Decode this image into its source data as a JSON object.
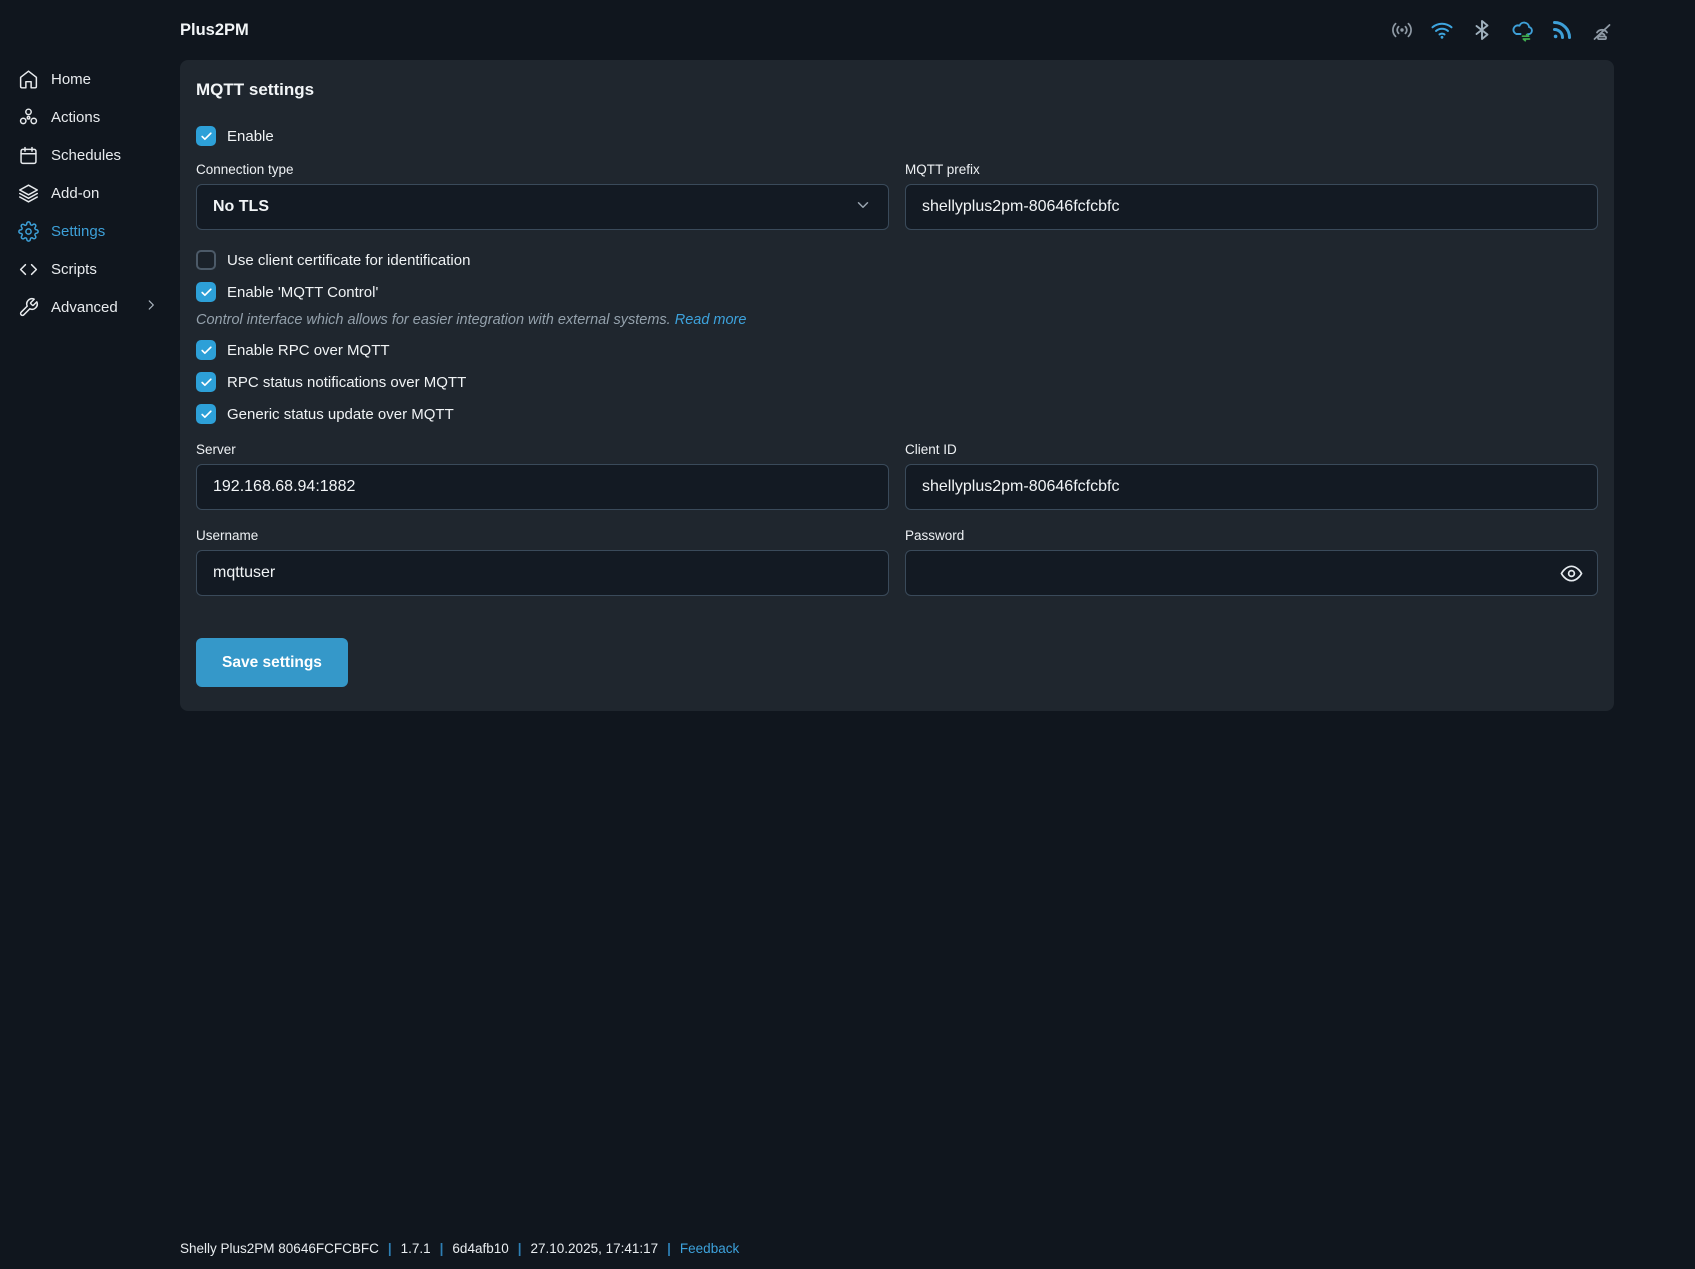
{
  "header": {
    "title": "Plus2PM",
    "status_icons": [
      "access-point",
      "wifi",
      "bluetooth",
      "cloud-sync",
      "mqtt",
      "range-extender-off"
    ]
  },
  "sidebar": {
    "items": [
      {
        "label": "Home",
        "icon": "home-icon",
        "active": false
      },
      {
        "label": "Actions",
        "icon": "actions-icon",
        "active": false
      },
      {
        "label": "Schedules",
        "icon": "calendar-icon",
        "active": false
      },
      {
        "label": "Add-on",
        "icon": "layers-icon",
        "active": false
      },
      {
        "label": "Settings",
        "icon": "gear-icon",
        "active": true
      },
      {
        "label": "Scripts",
        "icon": "code-icon",
        "active": false
      },
      {
        "label": "Advanced",
        "icon": "wrench-icon",
        "active": false,
        "has_chevron": true
      }
    ]
  },
  "panel": {
    "title": "MQTT settings",
    "enable": {
      "label": "Enable",
      "checked": true
    },
    "connection_type": {
      "label": "Connection type",
      "value": "No TLS"
    },
    "mqtt_prefix": {
      "label": "MQTT prefix",
      "value": "shellyplus2pm-80646fcfcbfc"
    },
    "use_cert": {
      "label": "Use client certificate for identification",
      "checked": false
    },
    "mqtt_control": {
      "label": "Enable 'MQTT Control'",
      "checked": true
    },
    "note": {
      "text": "Control interface which allows for easier integration with external systems.",
      "link": "Read more"
    },
    "rpc_over_mqtt": {
      "label": "Enable RPC over MQTT",
      "checked": true
    },
    "rpc_status": {
      "label": "RPC status notifications over MQTT",
      "checked": true
    },
    "generic_status": {
      "label": "Generic status update over MQTT",
      "checked": true
    },
    "server": {
      "label": "Server",
      "value": "192.168.68.94:1882"
    },
    "client_id": {
      "label": "Client ID",
      "value": "shellyplus2pm-80646fcfcbfc"
    },
    "username": {
      "label": "Username",
      "value": "mqttuser"
    },
    "password": {
      "label": "Password",
      "value": ""
    },
    "save_button": "Save settings"
  },
  "footer": {
    "device": "Shelly Plus2PM 80646FCFCBFC",
    "version": "1.7.1",
    "build": "6d4afb10",
    "datetime": "27.10.2025, 17:41:17",
    "feedback": "Feedback",
    "sep": "|"
  },
  "colors": {
    "accent_blue": "#3598c9",
    "checkbox_blue": "#2da0d8",
    "link_blue": "#3da2dc",
    "active_nav_blue": "#3da0d8",
    "panel_bg": "#1f262e",
    "page_bg": "#10161e",
    "input_bg": "#131a23",
    "input_border": "#3a4a5a",
    "cloud_arrow_green": "#3faa4f"
  }
}
